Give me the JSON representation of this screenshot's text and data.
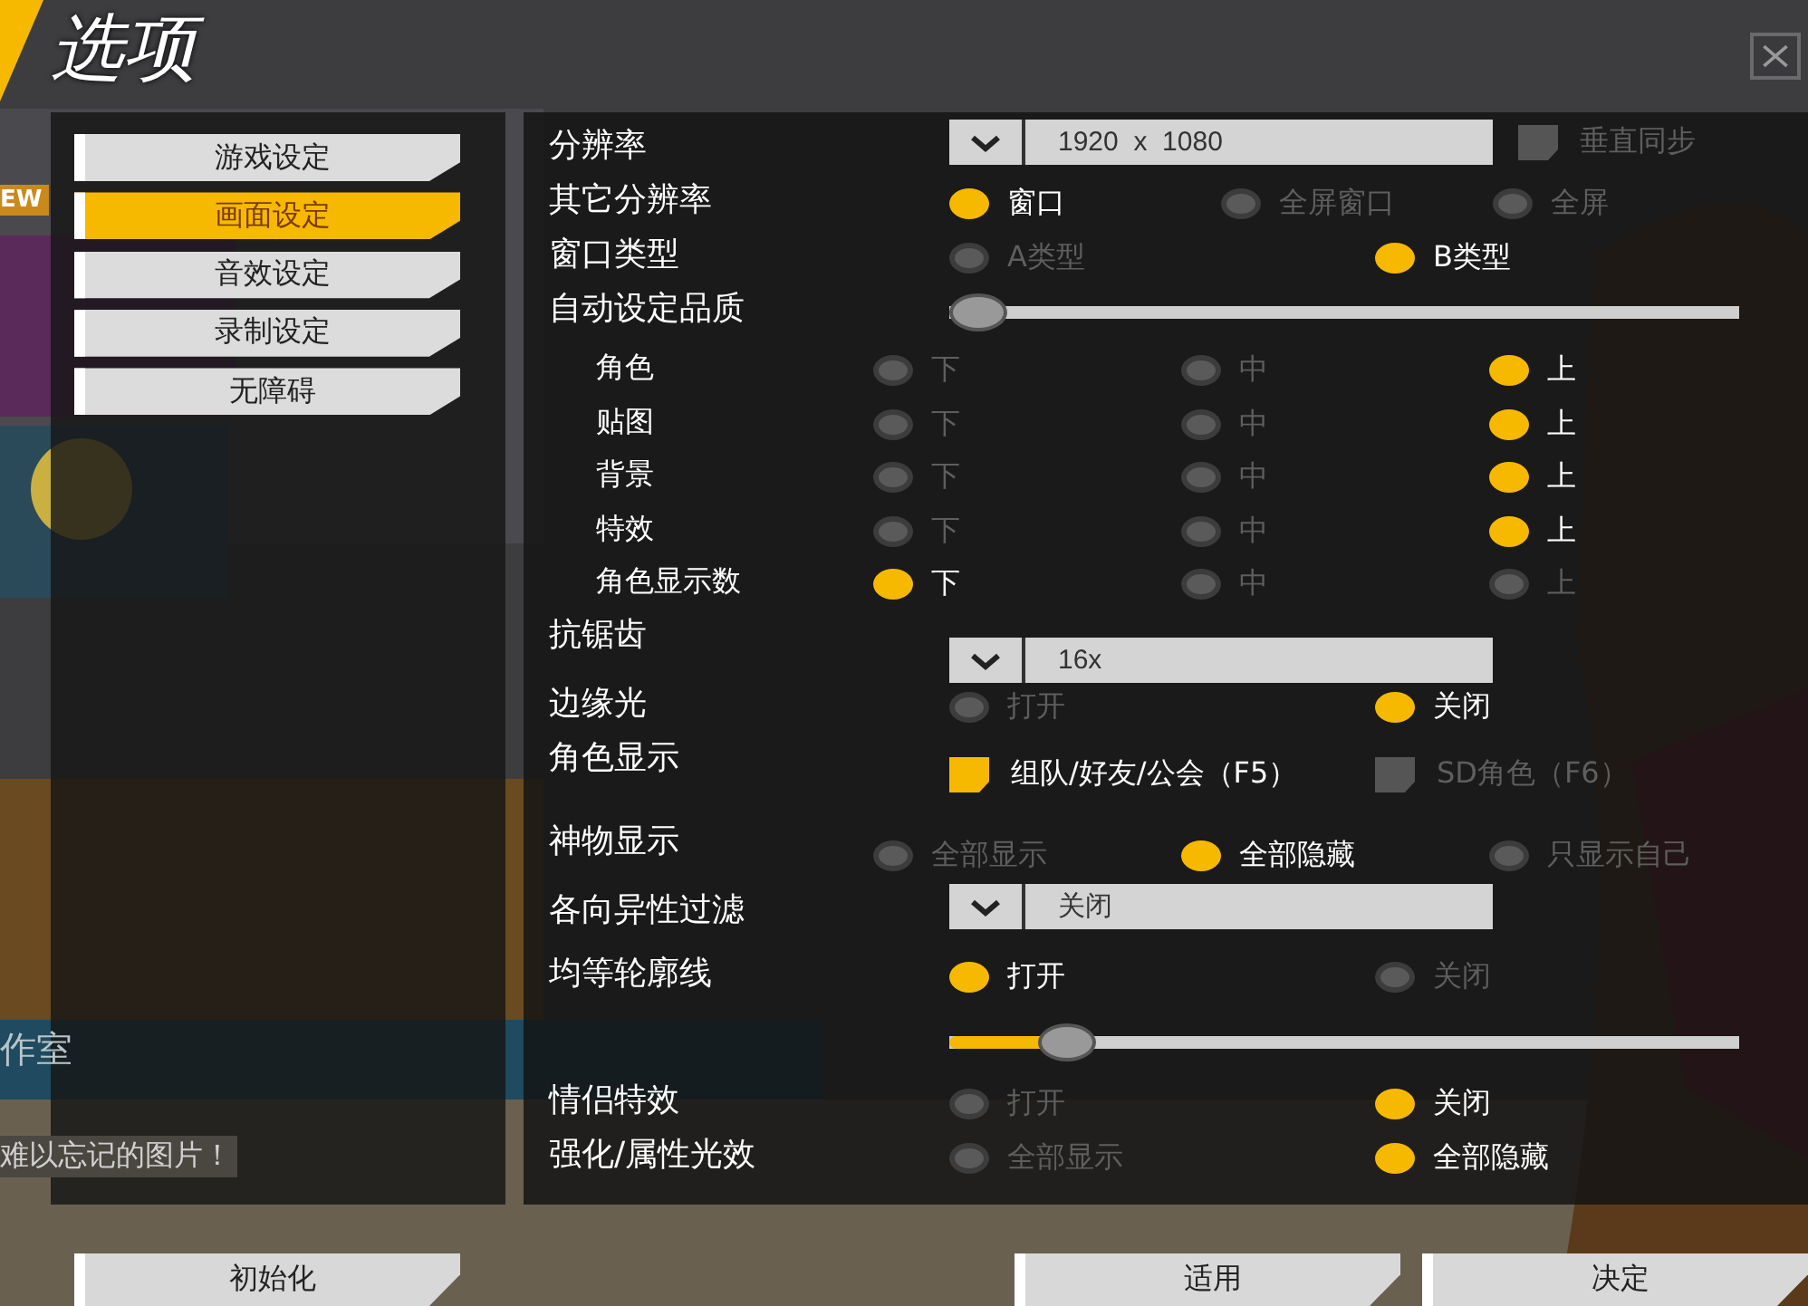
{
  "title": "选项",
  "background_texts": [
    {
      "kind": "badge",
      "text": "EW"
    },
    {
      "kind": "banner",
      "text": "作室"
    },
    {
      "kind": "caption",
      "text": "难以忘记的图片！"
    }
  ],
  "menu": [
    {
      "label": "游戏设定",
      "selected": false
    },
    {
      "label": "画面设定",
      "selected": true
    },
    {
      "label": "音效设定",
      "selected": false
    },
    {
      "label": "录制设定",
      "selected": false
    },
    {
      "label": "无障碍",
      "selected": false
    }
  ],
  "settings": [
    {
      "kind": "dropdown",
      "label": "分辨率",
      "value": "1920  x  1080",
      "checkbox": {
        "label": "垂直同步",
        "checked": false
      }
    },
    {
      "kind": "radio",
      "label": "其它分辨率",
      "options": [
        {
          "label": "窗口",
          "selected": true
        },
        {
          "label": "全屏窗口",
          "selected": false
        },
        {
          "label": "全屏",
          "selected": false
        }
      ]
    },
    {
      "kind": "radio",
      "label": "窗口类型",
      "options": [
        {
          "label": "A类型",
          "selected": false
        },
        {
          "label": "B类型",
          "selected": true
        }
      ]
    },
    {
      "kind": "slider",
      "label": "自动设定品质",
      "level": 0,
      "children": [
        {
          "kind": "tier",
          "label": "角色",
          "options": [
            {
              "label": "下",
              "selected": false
            },
            {
              "label": "中",
              "selected": false
            },
            {
              "label": "上",
              "selected": true
            }
          ]
        },
        {
          "kind": "tier",
          "label": "贴图",
          "options": [
            {
              "label": "下",
              "selected": false
            },
            {
              "label": "中",
              "selected": false
            },
            {
              "label": "上",
              "selected": true
            }
          ]
        },
        {
          "kind": "tier",
          "label": "背景",
          "options": [
            {
              "label": "下",
              "selected": false
            },
            {
              "label": "中",
              "selected": false
            },
            {
              "label": "上",
              "selected": true
            }
          ]
        },
        {
          "kind": "tier",
          "label": "特效",
          "options": [
            {
              "label": "下",
              "selected": false
            },
            {
              "label": "中",
              "selected": false
            },
            {
              "label": "上",
              "selected": true
            }
          ]
        },
        {
          "kind": "tier",
          "label": "角色显示数",
          "options": [
            {
              "label": "下",
              "selected": true
            },
            {
              "label": "中",
              "selected": false
            },
            {
              "label": "上",
              "selected": false
            }
          ]
        }
      ]
    },
    {
      "kind": "stacked_dropdown",
      "label": "抗锯齿",
      "value": "16x"
    },
    {
      "kind": "radio",
      "label": "边缘光",
      "options": [
        {
          "label": "打开",
          "selected": false
        },
        {
          "label": "关闭",
          "selected": true
        }
      ]
    },
    {
      "kind": "checks",
      "label": "角色显示",
      "checks": [
        {
          "label": "组队/好友/公会（F5）",
          "checked": true
        },
        {
          "label": "SD角色（F6）",
          "checked": false
        }
      ]
    },
    {
      "kind": "tier",
      "label": "神物显示",
      "options": [
        {
          "label": "全部显示",
          "selected": false
        },
        {
          "label": "全部隐藏",
          "selected": true
        },
        {
          "label": "只显示自己",
          "selected": false
        }
      ]
    },
    {
      "kind": "dropdown",
      "label": "各向异性过滤",
      "value": "关闭"
    },
    {
      "kind": "radio",
      "label": "均等轮廓线",
      "options": [
        {
          "label": "打开",
          "selected": true
        },
        {
          "label": "关闭",
          "selected": false
        }
      ]
    },
    {
      "kind": "slider",
      "level": 0.12
    },
    {
      "kind": "radio",
      "label": "情侣特效",
      "options": [
        {
          "label": "打开",
          "selected": false
        },
        {
          "label": "关闭",
          "selected": true
        }
      ]
    },
    {
      "kind": "radio",
      "label": "强化/属性光效",
      "options": [
        {
          "label": "全部显示",
          "selected": false
        },
        {
          "label": "全部隐藏",
          "selected": true
        }
      ]
    }
  ],
  "left_buttons": [
    "初始化"
  ],
  "right_buttons": [
    "适用",
    "决定"
  ]
}
